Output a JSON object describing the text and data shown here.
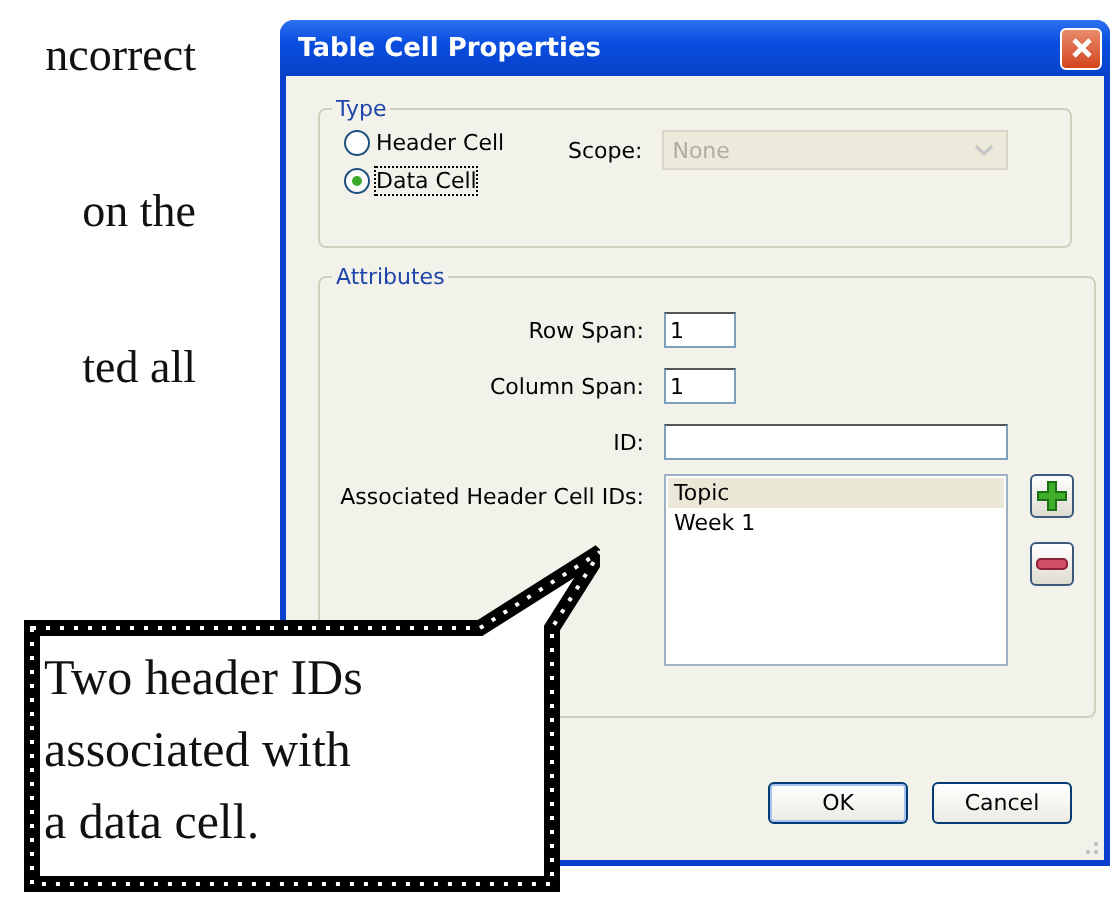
{
  "page_text": [
    "ncorrect",
    "on the",
    "ted all"
  ],
  "dialog": {
    "title": "Table Cell Properties",
    "type_group": {
      "legend": "Type",
      "options": [
        {
          "label": "Header Cell",
          "selected": false
        },
        {
          "label": "Data Cell",
          "selected": true
        }
      ],
      "scope": {
        "label": "Scope:",
        "value": "None",
        "disabled": true
      }
    },
    "attributes_group": {
      "legend": "Attributes",
      "fields": [
        {
          "kind": "short",
          "label": "Row Span:",
          "value": "1"
        },
        {
          "kind": "short",
          "label": "Column Span:",
          "value": "1"
        },
        {
          "kind": "long",
          "label": "ID:"
        }
      ],
      "header_ids": {
        "label": "Associated Header Cell IDs:",
        "items": [
          {
            "text": "Topic",
            "selected": true
          },
          {
            "text": "Week 1",
            "selected": false
          }
        ]
      }
    },
    "buttons": [
      "OK",
      "Cancel"
    ]
  },
  "callout": {
    "lines": [
      "Two header IDs",
      "associated with",
      "a data cell."
    ]
  }
}
